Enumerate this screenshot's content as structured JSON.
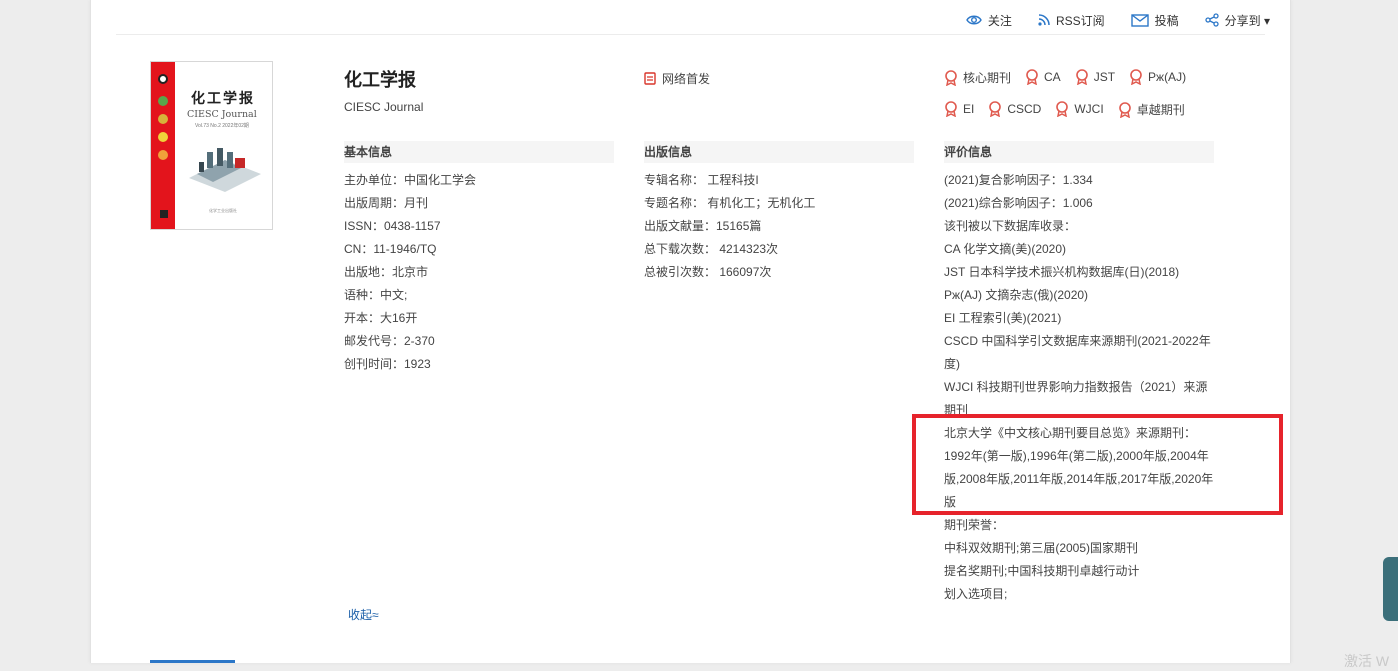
{
  "topbar": {
    "follow": "关注",
    "rss": "RSS订阅",
    "submit": "投稿",
    "share": "分享到 ▾"
  },
  "cover": {
    "title": "化工学报",
    "subtitle": "CIESC Journal",
    "vol": "Vol.73  No.2   2022年02期",
    "footer": "化学工业出版社",
    "strip_color": "#e3141c"
  },
  "journal": {
    "title": "化工学报",
    "subtitle": "CIESC Journal"
  },
  "net_first": "网络首发",
  "badges": {
    "row1": [
      "核心期刊",
      "CA",
      "JST",
      "Рж(AJ)"
    ],
    "row2": [
      "EI",
      "CSCD",
      "WJCI",
      "卓越期刊"
    ]
  },
  "basic": {
    "header": "基本信息",
    "rows": [
      "主办单位：中国化工学会",
      "出版周期：月刊",
      "ISSN：0438-1157",
      "CN：11-1946/TQ",
      "出版地：北京市",
      "语种：中文;",
      "开本：大16开",
      "邮发代号：2-370",
      "创刊时间：1923"
    ]
  },
  "publish": {
    "header": "出版信息",
    "rows": [
      "专辑名称： 工程科技I",
      "专题名称： 有机化工；无机化工",
      "出版文献量：15165篇",
      "总下载次数： 4214323次",
      "总被引次数： 166097次"
    ]
  },
  "evaluation": {
    "header": "评价信息",
    "rows": [
      "(2021)复合影响因子：1.334",
      "(2021)综合影响因子：1.006",
      "该刊被以下数据库收录：",
      "CA 化学文摘(美)(2020)",
      "JST 日本科学技术振兴机构数据库(日)(2018)",
      "Рж(AJ) 文摘杂志(俄)(2020)",
      "EI 工程索引(美)(2021)",
      "CSCD 中国科学引文数据库来源期刊(2021-2022年度)",
      "WJCI 科技期刊世界影响力指数报告（2021）来源期刊",
      "北京大学《中文核心期刊要目总览》来源期刊：",
      "1992年(第一版),1996年(第二版),2000年版,2004年版,2008年版,2011年版,2014年版,2017年版,2020年版",
      "期刊荣誉：",
      "中科双效期刊;第三届(2005)国家期刊提名奖期刊;中国科技期刊卓越行动计划入选项目;"
    ]
  },
  "collapse": "收起≈",
  "watermark": "激活 W",
  "colors": {
    "accent": "#1a5ea8",
    "highlight": "#e6232b",
    "badge": "#e05a4f",
    "icon_blue": "#2c77c8"
  }
}
